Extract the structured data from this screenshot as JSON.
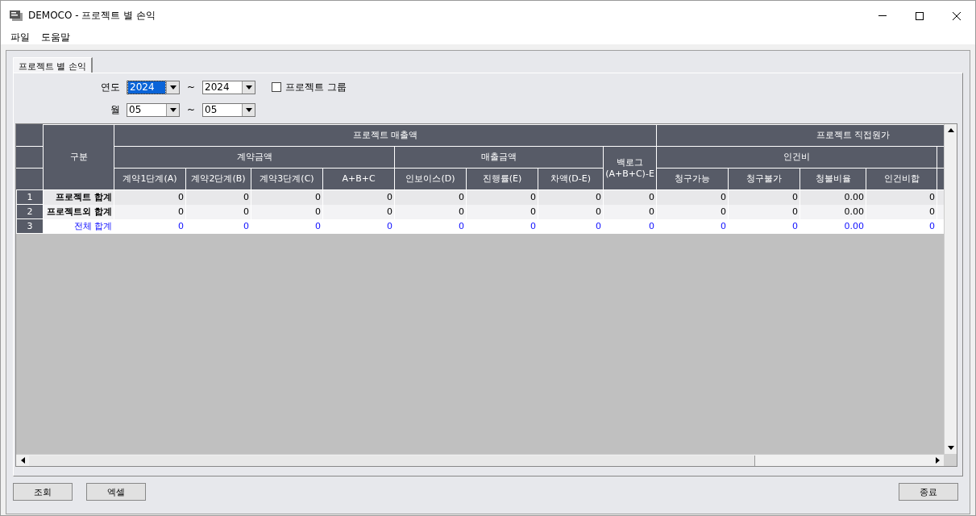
{
  "window": {
    "title": "DEMOCO - 프로젝트 별 손익"
  },
  "menu": [
    {
      "label": "파일"
    },
    {
      "label": "도움말"
    }
  ],
  "tabs": [
    {
      "label": "프로젝트 별 손익",
      "selected": true
    }
  ],
  "filters": {
    "year_label": "연도",
    "month_label": "월",
    "range_separator": "~",
    "year_from": {
      "value": "2024",
      "selected": true
    },
    "year_to": {
      "value": "2024",
      "selected": false
    },
    "month_from": {
      "value": "05",
      "selected": false
    },
    "month_to": {
      "value": "05",
      "selected": false
    },
    "group_checkbox": {
      "label": "프로젝트 그룹",
      "checked": false
    }
  },
  "table": {
    "row_header": "구분",
    "groups": [
      {
        "label": "프로젝트 매출액"
      },
      {
        "label": "프로젝트 직접원가"
      }
    ],
    "subgroups": [
      {
        "label": "계약금액"
      },
      {
        "label": "매출금액"
      },
      {
        "label": "백로그\n(A+B+C)-E"
      },
      {
        "label": "인건비"
      }
    ],
    "columns": [
      "계약1단계(A)",
      "계약2단계(B)",
      "계약3단계(C)",
      "A+B+C",
      "인보이스(D)",
      "진행률(E)",
      "차액(D-E)",
      "청구가능",
      "청구불가",
      "청불비율",
      "인건비합"
    ],
    "rows": [
      {
        "number": "1",
        "label": "프로젝트 합계",
        "kind": "subtotal",
        "values": [
          "0",
          "0",
          "0",
          "0",
          "0",
          "0",
          "0",
          "0",
          "0",
          "0",
          "0.00",
          "0"
        ]
      },
      {
        "number": "2",
        "label": "프로젝트외 합계",
        "kind": "subtotal",
        "values": [
          "0",
          "0",
          "0",
          "0",
          "0",
          "0",
          "0",
          "0",
          "0",
          "0",
          "0.00",
          "0"
        ]
      },
      {
        "number": "3",
        "label": "전체 합계",
        "kind": "total",
        "values": [
          "0",
          "0",
          "0",
          "0",
          "0",
          "0",
          "0",
          "0",
          "0",
          "0",
          "0.00",
          "0"
        ]
      }
    ]
  },
  "buttons": [
    {
      "label": "조회",
      "kind": "action"
    },
    {
      "label": "엑셀",
      "kind": "action"
    },
    {
      "label": "종료",
      "kind": "exit"
    }
  ]
}
